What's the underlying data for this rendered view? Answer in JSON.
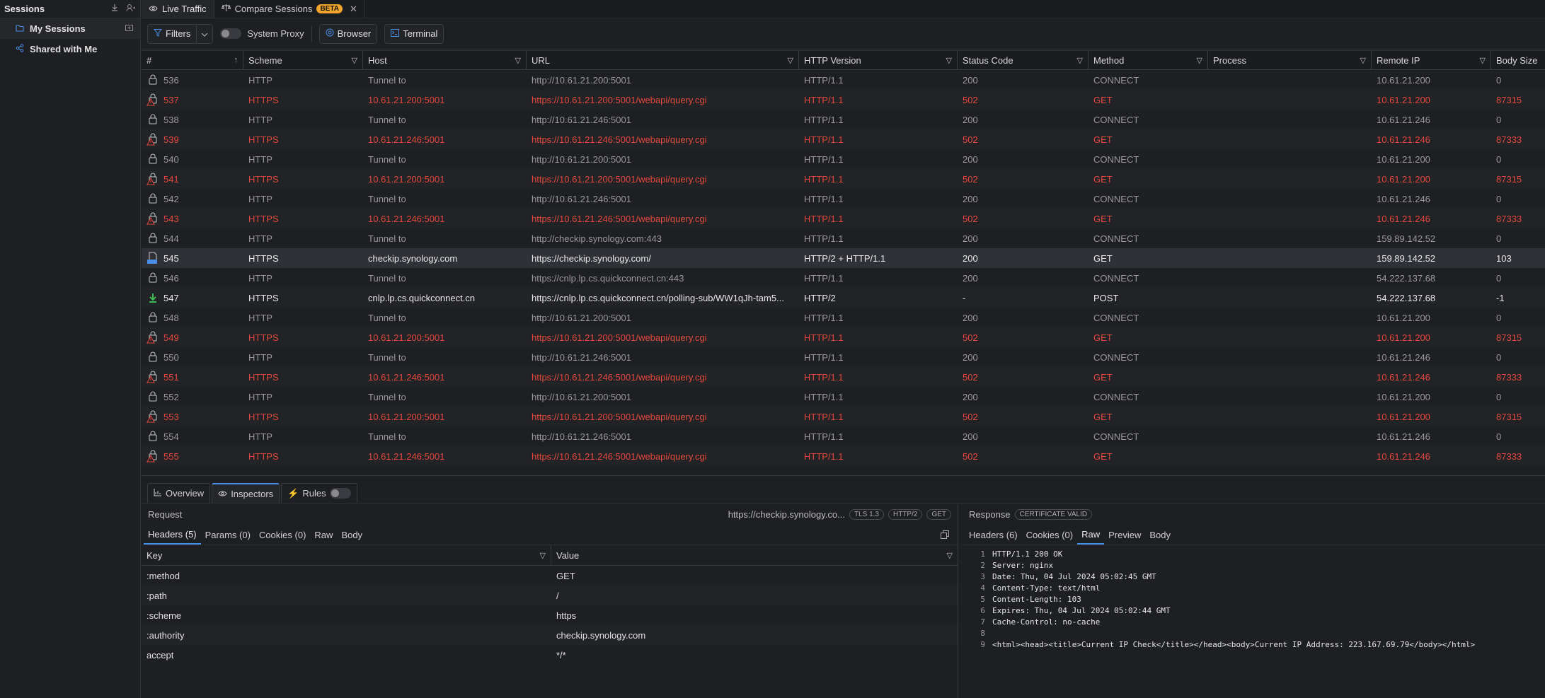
{
  "sidebar": {
    "title": "Sessions",
    "items": [
      {
        "label": "My Sessions",
        "icon": "folder-icon"
      },
      {
        "label": "Shared with Me",
        "icon": "share-icon"
      }
    ]
  },
  "tabs": [
    {
      "label": "Live Traffic",
      "icon": "eye-icon"
    },
    {
      "label": "Compare Sessions",
      "icon": "compare-icon",
      "badge": "BETA"
    }
  ],
  "toolbar": {
    "filters_label": "Filters",
    "system_proxy_label": "System Proxy",
    "browser_label": "Browser",
    "terminal_label": "Terminal"
  },
  "grid": {
    "columns": [
      "#",
      "Scheme",
      "Host",
      "URL",
      "HTTP Version",
      "Status Code",
      "Method",
      "Process",
      "Remote IP",
      "Body Size"
    ],
    "rows": [
      {
        "num": "536",
        "scheme": "HTTP",
        "host": "Tunnel to",
        "url": "http://10.61.21.200:5001",
        "ver": "HTTP/1.1",
        "status": "200",
        "method": "CONNECT",
        "process": "",
        "ip": "10.61.21.200",
        "size": "0",
        "kind": "tun"
      },
      {
        "num": "537",
        "scheme": "HTTPS",
        "host": "10.61.21.200:5001",
        "url": "https://10.61.21.200:5001/webapi/query.cgi",
        "ver": "HTTP/1.1",
        "status": "502",
        "method": "GET",
        "process": "",
        "ip": "10.61.21.200",
        "size": "87315",
        "kind": "err"
      },
      {
        "num": "538",
        "scheme": "HTTP",
        "host": "Tunnel to",
        "url": "http://10.61.21.246:5001",
        "ver": "HTTP/1.1",
        "status": "200",
        "method": "CONNECT",
        "process": "",
        "ip": "10.61.21.246",
        "size": "0",
        "kind": "tun"
      },
      {
        "num": "539",
        "scheme": "HTTPS",
        "host": "10.61.21.246:5001",
        "url": "https://10.61.21.246:5001/webapi/query.cgi",
        "ver": "HTTP/1.1",
        "status": "502",
        "method": "GET",
        "process": "",
        "ip": "10.61.21.246",
        "size": "87333",
        "kind": "err"
      },
      {
        "num": "540",
        "scheme": "HTTP",
        "host": "Tunnel to",
        "url": "http://10.61.21.200:5001",
        "ver": "HTTP/1.1",
        "status": "200",
        "method": "CONNECT",
        "process": "",
        "ip": "10.61.21.200",
        "size": "0",
        "kind": "tun"
      },
      {
        "num": "541",
        "scheme": "HTTPS",
        "host": "10.61.21.200:5001",
        "url": "https://10.61.21.200:5001/webapi/query.cgi",
        "ver": "HTTP/1.1",
        "status": "502",
        "method": "GET",
        "process": "",
        "ip": "10.61.21.200",
        "size": "87315",
        "kind": "err"
      },
      {
        "num": "542",
        "scheme": "HTTP",
        "host": "Tunnel to",
        "url": "http://10.61.21.246:5001",
        "ver": "HTTP/1.1",
        "status": "200",
        "method": "CONNECT",
        "process": "",
        "ip": "10.61.21.246",
        "size": "0",
        "kind": "tun"
      },
      {
        "num": "543",
        "scheme": "HTTPS",
        "host": "10.61.21.246:5001",
        "url": "https://10.61.21.246:5001/webapi/query.cgi",
        "ver": "HTTP/1.1",
        "status": "502",
        "method": "GET",
        "process": "",
        "ip": "10.61.21.246",
        "size": "87333",
        "kind": "err"
      },
      {
        "num": "544",
        "scheme": "HTTP",
        "host": "Tunnel to",
        "url": "http://checkip.synology.com:443",
        "ver": "HTTP/1.1",
        "status": "200",
        "method": "CONNECT",
        "process": "",
        "ip": "159.89.142.52",
        "size": "0",
        "kind": "tun"
      },
      {
        "num": "545",
        "scheme": "HTTPS",
        "host": "checkip.synology.com",
        "url": "https://checkip.synology.com/",
        "ver": "HTTP/2 + HTTP/1.1",
        "status": "200",
        "method": "GET",
        "process": "",
        "ip": "159.89.142.52",
        "size": "103",
        "kind": "ok",
        "selected": true
      },
      {
        "num": "546",
        "scheme": "HTTP",
        "host": "Tunnel to",
        "url": "https://cnlp.lp.cs.quickconnect.cn:443",
        "ver": "HTTP/1.1",
        "status": "200",
        "method": "CONNECT",
        "process": "",
        "ip": "54.222.137.68",
        "size": "0",
        "kind": "tun"
      },
      {
        "num": "547",
        "scheme": "HTTPS",
        "host": "cnlp.lp.cs.quickconnect.cn",
        "url": "https://cnlp.lp.cs.quickconnect.cn/polling-sub/WW1qJh-tam5...",
        "ver": "HTTP/2",
        "status": "-",
        "method": "POST",
        "process": "",
        "ip": "54.222.137.68",
        "size": "-1",
        "kind": "ok"
      },
      {
        "num": "548",
        "scheme": "HTTP",
        "host": "Tunnel to",
        "url": "http://10.61.21.200:5001",
        "ver": "HTTP/1.1",
        "status": "200",
        "method": "CONNECT",
        "process": "",
        "ip": "10.61.21.200",
        "size": "0",
        "kind": "tun"
      },
      {
        "num": "549",
        "scheme": "HTTPS",
        "host": "10.61.21.200:5001",
        "url": "https://10.61.21.200:5001/webapi/query.cgi",
        "ver": "HTTP/1.1",
        "status": "502",
        "method": "GET",
        "process": "",
        "ip": "10.61.21.200",
        "size": "87315",
        "kind": "err"
      },
      {
        "num": "550",
        "scheme": "HTTP",
        "host": "Tunnel to",
        "url": "http://10.61.21.246:5001",
        "ver": "HTTP/1.1",
        "status": "200",
        "method": "CONNECT",
        "process": "",
        "ip": "10.61.21.246",
        "size": "0",
        "kind": "tun"
      },
      {
        "num": "551",
        "scheme": "HTTPS",
        "host": "10.61.21.246:5001",
        "url": "https://10.61.21.246:5001/webapi/query.cgi",
        "ver": "HTTP/1.1",
        "status": "502",
        "method": "GET",
        "process": "",
        "ip": "10.61.21.246",
        "size": "87333",
        "kind": "err"
      },
      {
        "num": "552",
        "scheme": "HTTP",
        "host": "Tunnel to",
        "url": "http://10.61.21.200:5001",
        "ver": "HTTP/1.1",
        "status": "200",
        "method": "CONNECT",
        "process": "",
        "ip": "10.61.21.200",
        "size": "0",
        "kind": "tun"
      },
      {
        "num": "553",
        "scheme": "HTTPS",
        "host": "10.61.21.200:5001",
        "url": "https://10.61.21.200:5001/webapi/query.cgi",
        "ver": "HTTP/1.1",
        "status": "502",
        "method": "GET",
        "process": "",
        "ip": "10.61.21.200",
        "size": "87315",
        "kind": "err"
      },
      {
        "num": "554",
        "scheme": "HTTP",
        "host": "Tunnel to",
        "url": "http://10.61.21.246:5001",
        "ver": "HTTP/1.1",
        "status": "200",
        "method": "CONNECT",
        "process": "",
        "ip": "10.61.21.246",
        "size": "0",
        "kind": "tun"
      },
      {
        "num": "555",
        "scheme": "HTTPS",
        "host": "10.61.21.246:5001",
        "url": "https://10.61.21.246:5001/webapi/query.cgi",
        "ver": "HTTP/1.1",
        "status": "502",
        "method": "GET",
        "process": "",
        "ip": "10.61.21.246",
        "size": "87333",
        "kind": "err"
      }
    ]
  },
  "bottom": {
    "tabs": [
      "Overview",
      "Inspectors",
      "Rules"
    ],
    "request": {
      "label": "Request",
      "url": "https://checkip.synology.co...",
      "pills": [
        "TLS 1.3",
        "HTTP/2",
        "GET"
      ],
      "subtabs": [
        "Headers (5)",
        "Params (0)",
        "Cookies (0)",
        "Raw",
        "Body"
      ],
      "kv_columns": [
        "Key",
        "Value"
      ],
      "headers": [
        {
          "k": ":method",
          "v": "GET"
        },
        {
          "k": ":path",
          "v": "/"
        },
        {
          "k": ":scheme",
          "v": "https"
        },
        {
          "k": ":authority",
          "v": "checkip.synology.com"
        },
        {
          "k": "accept",
          "v": "*/*"
        }
      ]
    },
    "response": {
      "label": "Response",
      "cert": "CERTIFICATE VALID",
      "subtabs": [
        "Headers (6)",
        "Cookies (0)",
        "Raw",
        "Preview",
        "Body"
      ],
      "lines": [
        "HTTP/1.1 200 OK",
        "Server: nginx",
        "Date: Thu, 04 Jul 2024 05:02:45 GMT",
        "Content-Type: text/html",
        "Content-Length: 103",
        "Expires: Thu, 04 Jul 2024 05:02:44 GMT",
        "Cache-Control: no-cache",
        "",
        "<html><head><title>Current IP Check</title></head><body>Current IP Address: 223.167.69.79</body></html>"
      ]
    }
  },
  "colors": {
    "accent": "#4a8fe7",
    "error": "#e5483d",
    "beta": "#f4a52c",
    "download": "#3fb950"
  }
}
